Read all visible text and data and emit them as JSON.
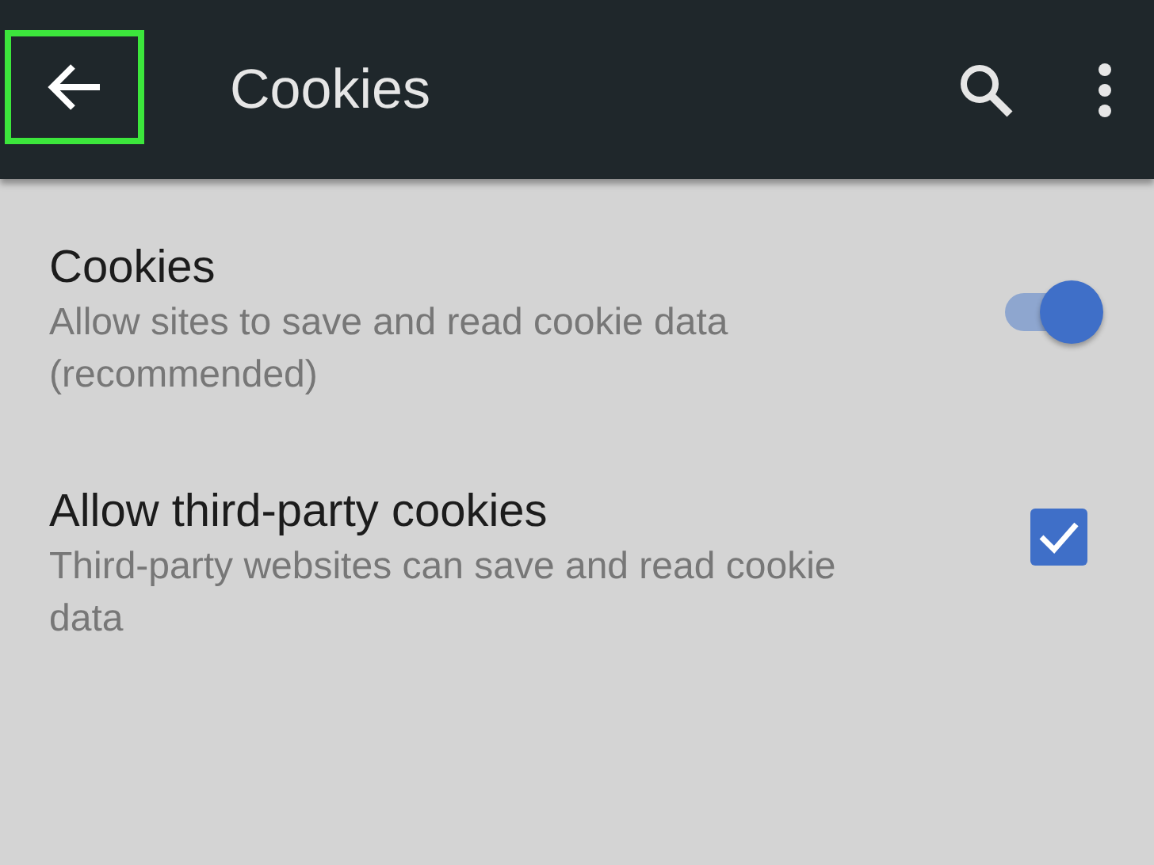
{
  "toolbar": {
    "title": "Cookies",
    "back_highlighted": true
  },
  "settings": [
    {
      "kind": "switch",
      "title": "Cookies",
      "description": "Allow sites to save and read cookie data (recommended)",
      "on": true
    },
    {
      "kind": "checkbox",
      "title": "Allow third-party cookies",
      "description": "Third-party websites can save and read cookie data",
      "checked": true
    }
  ]
}
